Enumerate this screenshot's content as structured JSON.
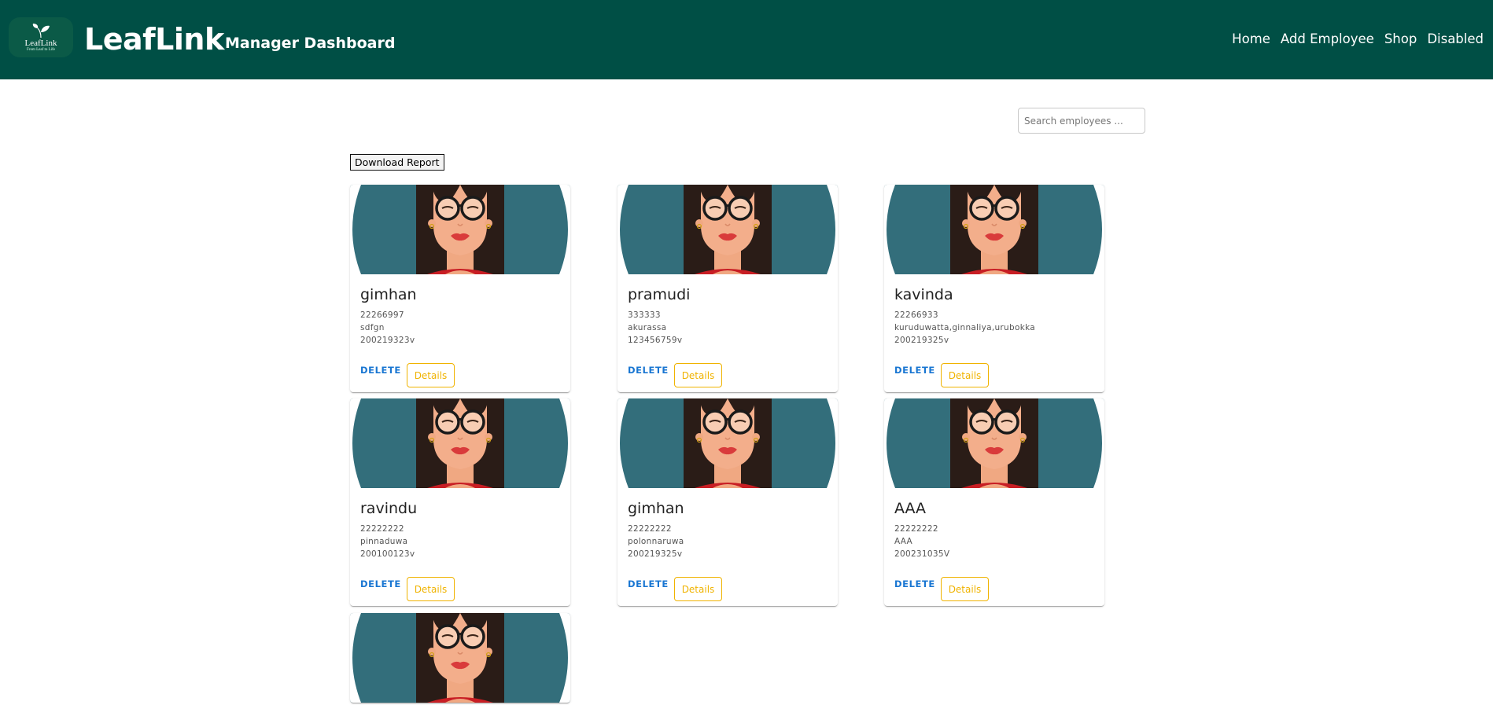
{
  "header": {
    "logo_text": "LeafLink",
    "logo_tagline": "From Leaf to Life",
    "brand": "LeafLink",
    "subtitle": "Manager Dashboard",
    "nav": [
      {
        "label": "Home"
      },
      {
        "label": "Add Employee"
      },
      {
        "label": "Shop"
      },
      {
        "label": "Disabled"
      }
    ],
    "colors": {
      "background": "#004f45",
      "text": "#ffffff"
    }
  },
  "search": {
    "placeholder": "Search employees ...",
    "value": ""
  },
  "download_label": "Download Report",
  "employees": [
    {
      "name": "gimhan",
      "phone": "22266997",
      "address": "sdfgn",
      "nic": "200219323v"
    },
    {
      "name": "pramudi",
      "phone": "333333",
      "address": "akurassa",
      "nic": "123456759v"
    },
    {
      "name": "kavinda",
      "phone": "22266933",
      "address": "kuruduwatta,ginnaliya,urubokka",
      "nic": "200219325v"
    },
    {
      "name": "ravindu",
      "phone": "22222222",
      "address": "pinnaduwa",
      "nic": "200100123v"
    },
    {
      "name": "gimhan",
      "phone": "22222222",
      "address": "polonnaruwa",
      "nic": "200219325v"
    },
    {
      "name": "AAA",
      "phone": "22222222",
      "address": "AAA",
      "nic": "200231035V"
    }
  ],
  "card_actions": {
    "delete_label": "DELETE",
    "details_label": "Details"
  },
  "colors": {
    "delete": "#1976d2",
    "details": "#f0b300",
    "avatar_bg": "#336e7b"
  },
  "icons": {
    "avatar": "woman-with-glasses-avatar",
    "logo": "leaf-icon"
  }
}
